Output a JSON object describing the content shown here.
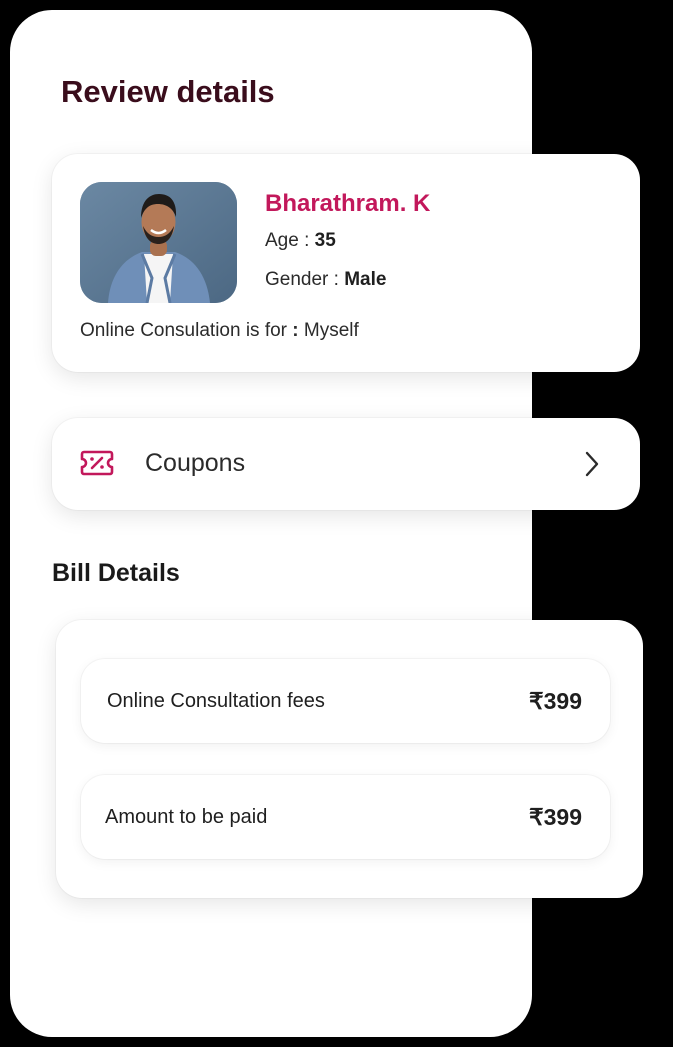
{
  "page": {
    "title": "Review details"
  },
  "patient": {
    "name": "Bharathram. K",
    "age_label": "Age : ",
    "age_value": "35",
    "gender_label": "Gender : ",
    "gender_value": "Male",
    "consult_for_label": "Online Consulation is for ",
    "consult_for_colon": ":",
    "consult_for_value": " Myself"
  },
  "coupons": {
    "label": "Coupons",
    "icon": "ticket-icon",
    "chevron": "chevron-right-icon"
  },
  "bill": {
    "title": "Bill Details",
    "rows": [
      {
        "label": "Online Consultation fees",
        "amount": "₹399"
      },
      {
        "label": "Amount to be paid",
        "amount": "₹399"
      }
    ]
  },
  "colors": {
    "accent": "#c2185b",
    "title": "#3a0d1c",
    "background": "#000000",
    "surface": "#ffffff"
  }
}
